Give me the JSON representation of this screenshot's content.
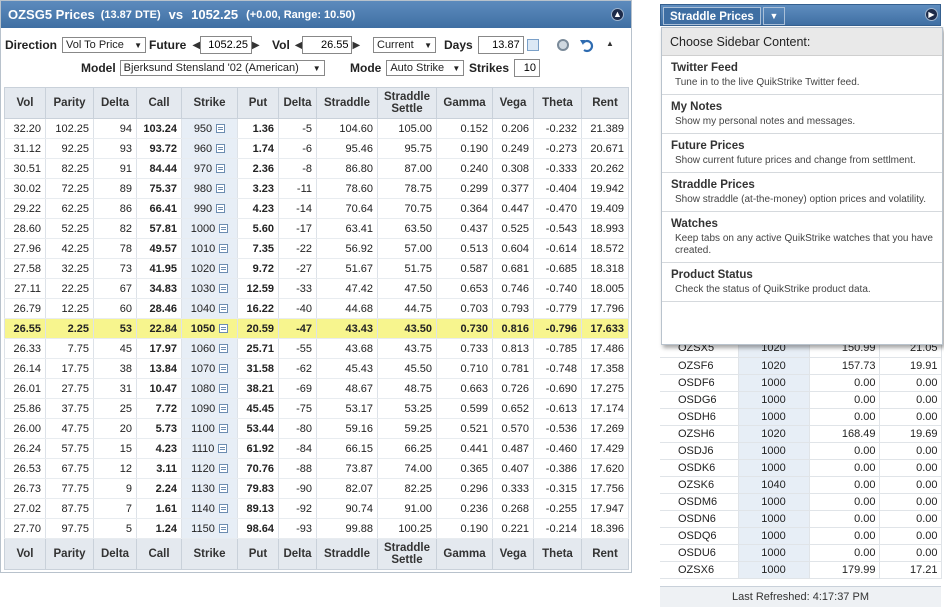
{
  "header": {
    "symbol_title": "OZSG5 Prices",
    "dte": "(13.87 DTE)",
    "vs": "vs",
    "price": "1052.25",
    "change": "(+0.00,  Range: 10.50)"
  },
  "controls": {
    "direction_label": "Direction",
    "direction_value": "Vol To Price",
    "future_label": "Future",
    "future_value": "1052.25",
    "vol_label": "Vol",
    "vol_value": "26.55",
    "vol_mode_value": "Current",
    "days_label": "Days",
    "days_value": "13.87",
    "model_label": "Model",
    "model_value": "Bjerksund Stensland '02 (American)",
    "mode_label": "Mode",
    "mode_value": "Auto Strike",
    "strikes_label": "Strikes",
    "strikes_value": "10"
  },
  "grid": {
    "columns": [
      "Vol",
      "Parity",
      "Delta",
      "Call",
      "Strike",
      "Put",
      "Delta",
      "Straddle",
      "Straddle Settle",
      "Gamma",
      "Vega",
      "Theta",
      "Rent"
    ],
    "rows": [
      [
        "32.20",
        "102.25",
        "94",
        "103.24",
        "950",
        "1.36",
        "-5",
        "104.60",
        "105.00",
        "0.152",
        "0.206",
        "-0.232",
        "21.389"
      ],
      [
        "31.12",
        "92.25",
        "93",
        "93.72",
        "960",
        "1.74",
        "-6",
        "95.46",
        "95.75",
        "0.190",
        "0.249",
        "-0.273",
        "20.671"
      ],
      [
        "30.51",
        "82.25",
        "91",
        "84.44",
        "970",
        "2.36",
        "-8",
        "86.80",
        "87.00",
        "0.240",
        "0.308",
        "-0.333",
        "20.262"
      ],
      [
        "30.02",
        "72.25",
        "89",
        "75.37",
        "980",
        "3.23",
        "-11",
        "78.60",
        "78.75",
        "0.299",
        "0.377",
        "-0.404",
        "19.942"
      ],
      [
        "29.22",
        "62.25",
        "86",
        "66.41",
        "990",
        "4.23",
        "-14",
        "70.64",
        "70.75",
        "0.364",
        "0.447",
        "-0.470",
        "19.409"
      ],
      [
        "28.60",
        "52.25",
        "82",
        "57.81",
        "1000",
        "5.60",
        "-17",
        "63.41",
        "63.50",
        "0.437",
        "0.525",
        "-0.543",
        "18.993"
      ],
      [
        "27.96",
        "42.25",
        "78",
        "49.57",
        "1010",
        "7.35",
        "-22",
        "56.92",
        "57.00",
        "0.513",
        "0.604",
        "-0.614",
        "18.572"
      ],
      [
        "27.58",
        "32.25",
        "73",
        "41.95",
        "1020",
        "9.72",
        "-27",
        "51.67",
        "51.75",
        "0.587",
        "0.681",
        "-0.685",
        "18.318"
      ],
      [
        "27.11",
        "22.25",
        "67",
        "34.83",
        "1030",
        "12.59",
        "-33",
        "47.42",
        "47.50",
        "0.653",
        "0.746",
        "-0.740",
        "18.005"
      ],
      [
        "26.79",
        "12.25",
        "60",
        "28.46",
        "1040",
        "16.22",
        "-40",
        "44.68",
        "44.75",
        "0.703",
        "0.793",
        "-0.779",
        "17.796"
      ],
      [
        "26.55",
        "2.25",
        "53",
        "22.84",
        "1050",
        "20.59",
        "-47",
        "43.43",
        "43.50",
        "0.730",
        "0.816",
        "-0.796",
        "17.633"
      ],
      [
        "26.33",
        "7.75",
        "45",
        "17.97",
        "1060",
        "25.71",
        "-55",
        "43.68",
        "43.75",
        "0.733",
        "0.813",
        "-0.785",
        "17.486"
      ],
      [
        "26.14",
        "17.75",
        "38",
        "13.84",
        "1070",
        "31.58",
        "-62",
        "45.43",
        "45.50",
        "0.710",
        "0.781",
        "-0.748",
        "17.358"
      ],
      [
        "26.01",
        "27.75",
        "31",
        "10.47",
        "1080",
        "38.21",
        "-69",
        "48.67",
        "48.75",
        "0.663",
        "0.726",
        "-0.690",
        "17.275"
      ],
      [
        "25.86",
        "37.75",
        "25",
        "7.72",
        "1090",
        "45.45",
        "-75",
        "53.17",
        "53.25",
        "0.599",
        "0.652",
        "-0.613",
        "17.174"
      ],
      [
        "26.00",
        "47.75",
        "20",
        "5.73",
        "1100",
        "53.44",
        "-80",
        "59.16",
        "59.25",
        "0.521",
        "0.570",
        "-0.536",
        "17.269"
      ],
      [
        "26.24",
        "57.75",
        "15",
        "4.23",
        "1110",
        "61.92",
        "-84",
        "66.15",
        "66.25",
        "0.441",
        "0.487",
        "-0.460",
        "17.429"
      ],
      [
        "26.53",
        "67.75",
        "12",
        "3.11",
        "1120",
        "70.76",
        "-88",
        "73.87",
        "74.00",
        "0.365",
        "0.407",
        "-0.386",
        "17.620"
      ],
      [
        "26.73",
        "77.75",
        "9",
        "2.24",
        "1130",
        "79.83",
        "-90",
        "82.07",
        "82.25",
        "0.296",
        "0.333",
        "-0.315",
        "17.756"
      ],
      [
        "27.02",
        "87.75",
        "7",
        "1.61",
        "1140",
        "89.13",
        "-92",
        "90.74",
        "91.00",
        "0.236",
        "0.268",
        "-0.255",
        "17.947"
      ],
      [
        "27.70",
        "97.75",
        "5",
        "1.24",
        "1150",
        "98.64",
        "-93",
        "99.88",
        "100.25",
        "0.190",
        "0.221",
        "-0.214",
        "18.396"
      ]
    ],
    "atm_index": 10
  },
  "sidebar": {
    "tab_label": "Straddle Prices",
    "menu_title": "Choose Sidebar Content:",
    "menu_items": [
      {
        "title": "Twitter Feed",
        "desc": "Tune in to the live QuikStrike Twitter feed."
      },
      {
        "title": "My Notes",
        "desc": "Show my personal notes and messages."
      },
      {
        "title": "Future Prices",
        "desc": "Show current future prices and change from settlment."
      },
      {
        "title": "Straddle Prices",
        "desc": "Show straddle (at-the-money) option prices and volatility."
      },
      {
        "title": "Watches",
        "desc": "Keep tabs on any active QuikStrike watches that you have created."
      },
      {
        "title": "Product Status",
        "desc": "Check the status of QuikStrike product data."
      }
    ],
    "straddle_rows": [
      [
        "OZSX5",
        "1020",
        "150.99",
        "21.05"
      ],
      [
        "OZSF6",
        "1020",
        "157.73",
        "19.91"
      ],
      [
        "OSDF6",
        "1000",
        "0.00",
        "0.00"
      ],
      [
        "OSDG6",
        "1000",
        "0.00",
        "0.00"
      ],
      [
        "OSDH6",
        "1000",
        "0.00",
        "0.00"
      ],
      [
        "OZSH6",
        "1020",
        "168.49",
        "19.69"
      ],
      [
        "OSDJ6",
        "1000",
        "0.00",
        "0.00"
      ],
      [
        "OSDK6",
        "1000",
        "0.00",
        "0.00"
      ],
      [
        "OZSK6",
        "1040",
        "0.00",
        "0.00"
      ],
      [
        "OSDM6",
        "1000",
        "0.00",
        "0.00"
      ],
      [
        "OSDN6",
        "1000",
        "0.00",
        "0.00"
      ],
      [
        "OSDQ6",
        "1000",
        "0.00",
        "0.00"
      ],
      [
        "OSDU6",
        "1000",
        "0.00",
        "0.00"
      ],
      [
        "OZSX6",
        "1000",
        "179.99",
        "17.21"
      ]
    ],
    "last_refreshed": "Last Refreshed: 4:17:37 PM"
  },
  "icons": {
    "collapse": "chevron-up-circle-icon",
    "calendar": "calendar-icon",
    "settings": "gear-icon",
    "refresh": "undo-refresh-icon",
    "sidebar_next": "chevron-right-circle-icon"
  },
  "colors": {
    "title_bar": "#4a79ad",
    "atm_highlight": "#f7f58e",
    "header_bg": "#e4e9ef",
    "strike_bg": "#e7eef6"
  }
}
